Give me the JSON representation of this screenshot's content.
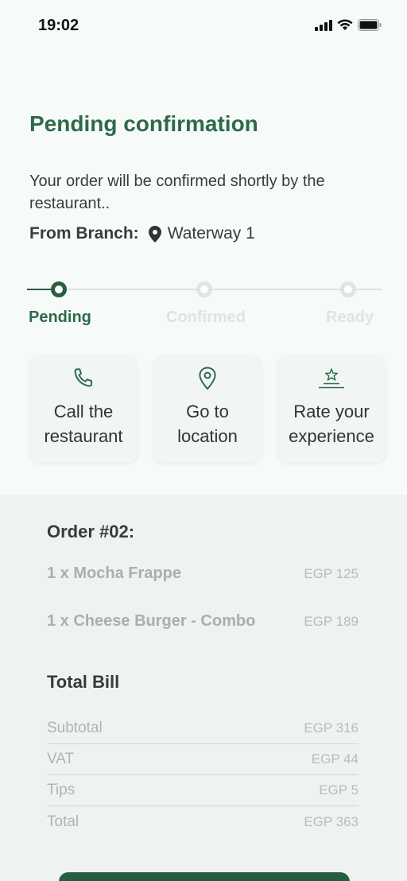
{
  "status_bar": {
    "time": "19:02"
  },
  "header": {
    "title": "Pending confirmation",
    "subtitle": "Your order will be confirmed shortly by the restaurant..",
    "branch_label": "From Branch:",
    "branch_name": "Waterway 1"
  },
  "progress": {
    "current_step": 1,
    "steps": [
      {
        "label": "Pending",
        "state": "active"
      },
      {
        "label": "Confirmed",
        "state": "inactive"
      },
      {
        "label": "Ready",
        "state": "inactive"
      }
    ]
  },
  "actions": [
    {
      "label_line1": "Call the",
      "label_line2": "restaurant",
      "icon": "phone-icon"
    },
    {
      "label_line1": "Go to",
      "label_line2": "location",
      "icon": "location-pin-icon"
    },
    {
      "label_line1": "Rate your",
      "label_line2": "experience",
      "icon": "star-rating-icon"
    }
  ],
  "order": {
    "title": "Order #02:",
    "items": [
      {
        "name": "1 x Mocha Frappe",
        "price": "EGP 125"
      },
      {
        "name": "1 x Cheese Burger - Combo",
        "price": "EGP 189"
      }
    ]
  },
  "bill": {
    "title": "Total Bill",
    "rows": [
      {
        "label": "Subtotal",
        "value": "EGP 316"
      },
      {
        "label": "VAT",
        "value": "EGP 44"
      },
      {
        "label": "Tips",
        "value": "EGP 5"
      },
      {
        "label": "Total",
        "value": "EGP 363"
      }
    ]
  },
  "colors": {
    "accent": "#255e40",
    "title_green": "#2e6a4a",
    "background": "#f6fbfa",
    "section_background": "#eef2f2"
  }
}
